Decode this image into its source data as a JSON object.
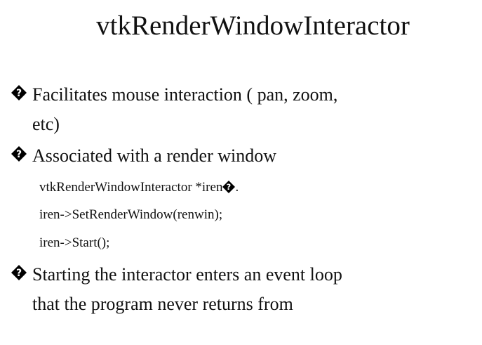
{
  "slide": {
    "title": "vtkRenderWindowInteractor",
    "bullets": [
      {
        "icon": "replacement-char-icon",
        "lines": [
          "Facilitates mouse interaction ( pan, zoom,",
          "etc)"
        ]
      },
      {
        "icon": "replacement-char-icon",
        "lines": [
          "Associated with a render window"
        ]
      },
      {
        "icon": "replacement-char-icon",
        "lines": [
          "Starting the interactor enters an event loop",
          "that the program never returns from"
        ]
      }
    ],
    "code": {
      "line1_before": "vtkRenderWindowInteractor *iren",
      "line1_after": ".",
      "line2": "iren->SetRenderWindow(renwin);",
      "line3": "iren->Start();"
    }
  }
}
